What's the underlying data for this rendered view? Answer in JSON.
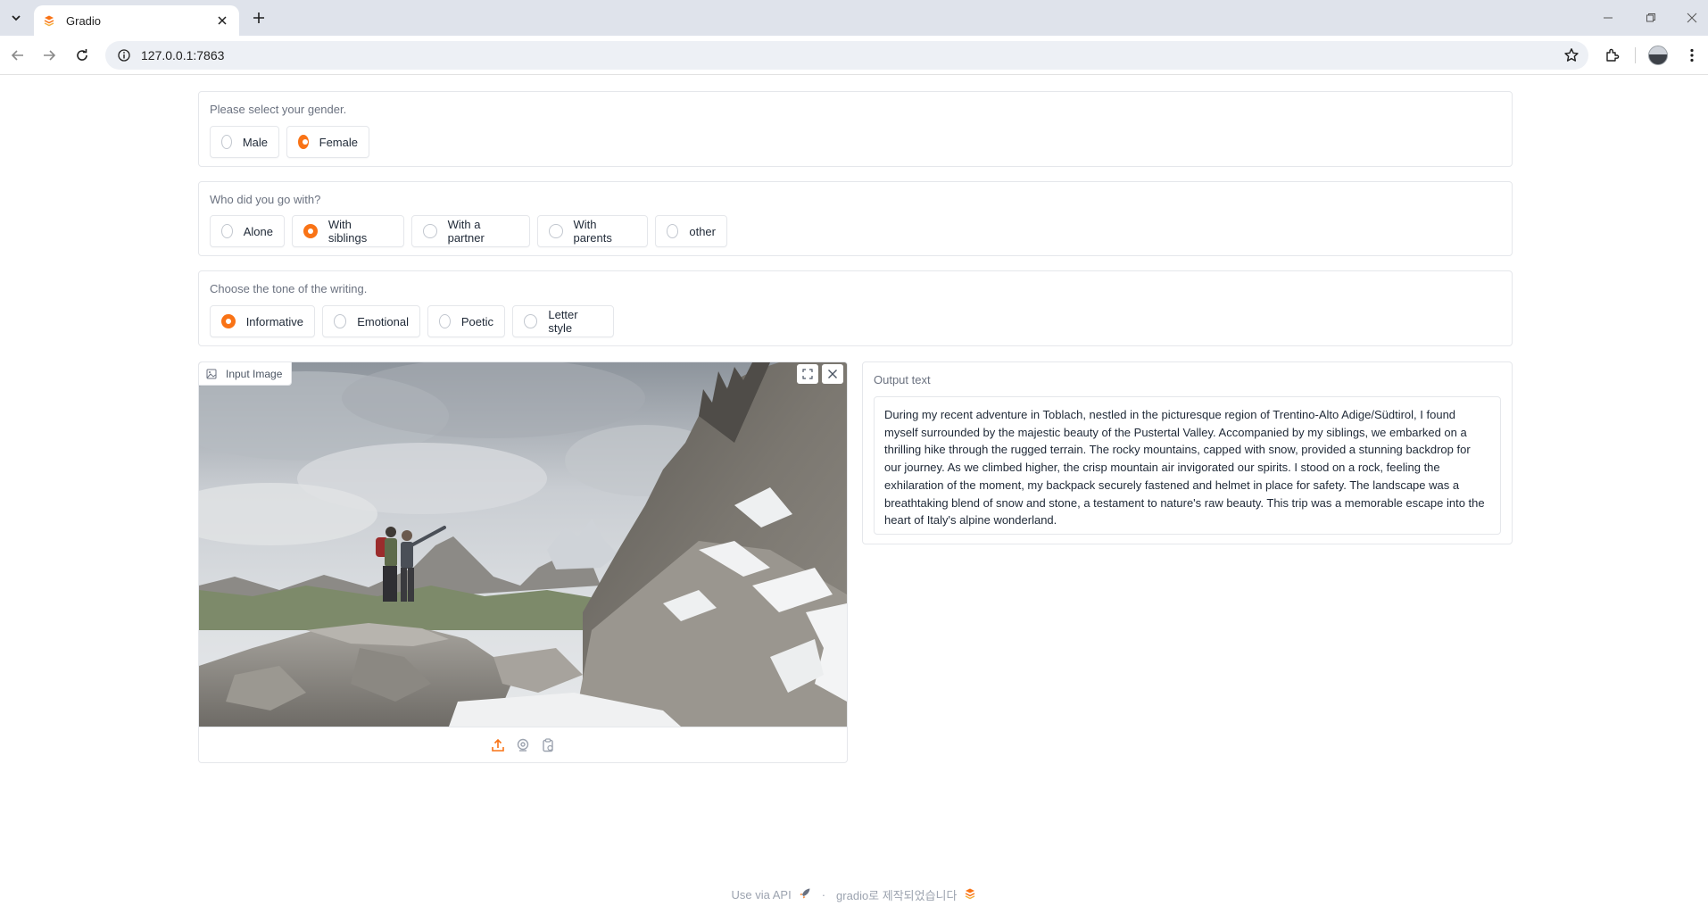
{
  "browser": {
    "tab_title": "Gradio",
    "url": "127.0.0.1:7863"
  },
  "gender": {
    "label": "Please select your gender.",
    "options": [
      "Male",
      "Female"
    ],
    "selected": "Female"
  },
  "companion": {
    "label": "Who did you go with?",
    "options": [
      "Alone",
      "With siblings",
      "With a partner",
      "With parents",
      "other"
    ],
    "selected": "With siblings"
  },
  "tone": {
    "label": "Choose the tone of the writing.",
    "options": [
      "Informative",
      "Emotional",
      "Poetic",
      "Letter style"
    ],
    "selected": "Informative"
  },
  "input_image": {
    "label": "Input Image"
  },
  "output": {
    "label": "Output text",
    "value": "During my recent adventure in Toblach, nestled in the picturesque region of Trentino-Alto Adige/Südtirol, I found myself surrounded by the majestic beauty of the Pustertal Valley. Accompanied by my siblings, we embarked on a thrilling hike through the rugged terrain. The rocky mountains, capped with snow, provided a stunning backdrop for our journey. As we climbed higher, the crisp mountain air invigorated our spirits. I stood on a rock, feeling the exhilaration of the moment, my backpack securely fastened and helmet in place for safety. The landscape was a breathtaking blend of snow and stone, a testament to nature's raw beauty. This trip was a memorable escape into the heart of Italy's alpine wonderland."
  },
  "footer": {
    "api_link": "Use via API",
    "separator": "·",
    "built_with": "gradio로 제작되었습니다"
  },
  "colors": {
    "accent": "#f97316",
    "border": "#e5e7eb",
    "label_text": "#6b7280"
  }
}
